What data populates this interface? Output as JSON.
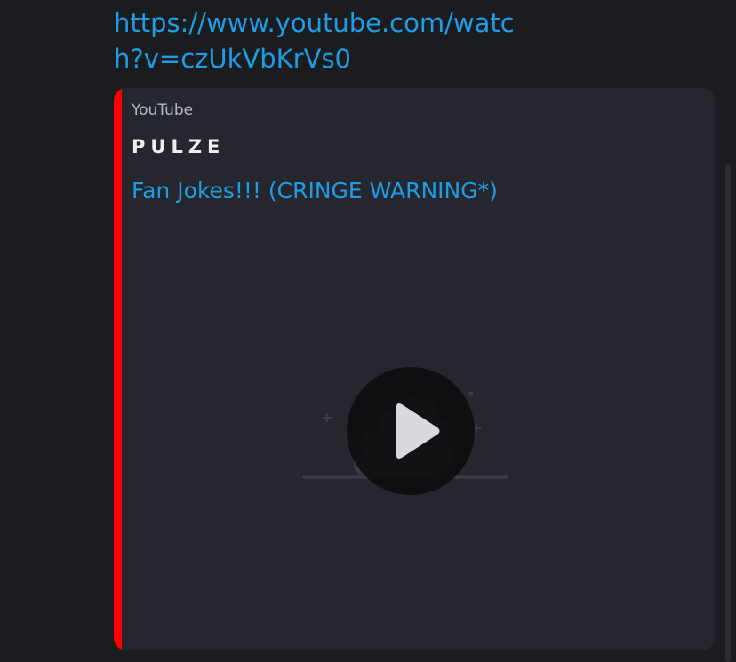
{
  "message": {
    "link_text": "https://www.youtube.com/watch?v=czUkVbKrVs0"
  },
  "embed": {
    "provider": "YouTube",
    "author": "PULZE",
    "title": "Fan Jokes!!! (CRINGE WARNING*)",
    "accent_color": "#ff0000",
    "thumbnail_icon": "poop-placeholder-icon",
    "play_icon": "play-icon"
  },
  "colors": {
    "background": "#1b1c20",
    "embed_background": "#26272e",
    "link": "#1e9de5"
  }
}
